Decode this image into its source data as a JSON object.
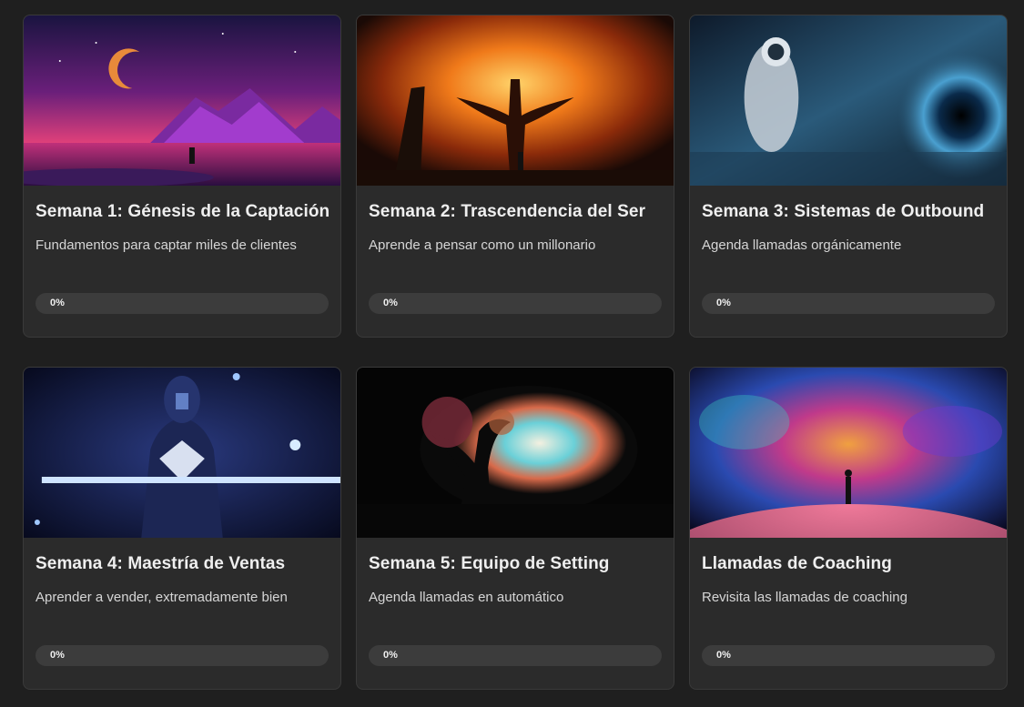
{
  "courses": [
    {
      "title": "Semana 1: Génesis de la Captación",
      "description": "Fundamentos para captar miles de clientes",
      "progress_label": "0%",
      "progress": 0,
      "image": "neon-mountain-lake-landscape"
    },
    {
      "title": "Semana 2: Trascendencia del Ser",
      "description": "Aprende a pensar como un millonario",
      "progress_label": "0%",
      "progress": 0,
      "image": "burning-tree-warrior"
    },
    {
      "title": "Semana 3: Sistemas de Outbound",
      "description": "Agenda llamadas orgánicamente",
      "progress_label": "0%",
      "progress": 0,
      "image": "astronaut-black-hole"
    },
    {
      "title": "Semana 4: Maestría de Ventas",
      "description": "Aprender a vender, extremadamente bien",
      "progress_label": "0%",
      "progress": 0,
      "image": "armored-knight-glowing-sword"
    },
    {
      "title": "Semana 5: Equipo de Setting",
      "description": "Agenda llamadas en automático",
      "progress_label": "0%",
      "progress": 0,
      "image": "fantasy-cliff-tree-vista"
    },
    {
      "title": "Llamadas de Coaching",
      "description": "Revisita las llamadas de coaching",
      "progress_label": "0%",
      "progress": 0,
      "image": "cosmic-nebula-planet-figure"
    }
  ],
  "colors": {
    "background": "#1f1f1f",
    "card": "#2b2b2b",
    "progress_track": "#3c3c3c"
  }
}
